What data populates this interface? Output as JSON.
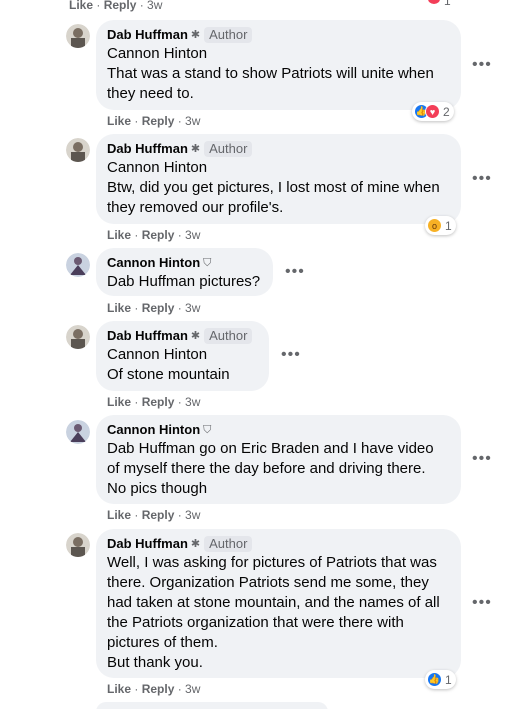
{
  "top": {
    "actions": {
      "like": "Like",
      "sep1": " · ",
      "reply": "Reply",
      "sep2": " · ",
      "time": "3w"
    },
    "reaction_count": "1"
  },
  "comments": [
    {
      "author": "Dab Huffman",
      "badge": "Author",
      "mention": "Cannon Hinton",
      "text": "That was a stand to show Patriots will unite when\nthey need to.",
      "actions": {
        "like": "Like",
        "reply": "Reply",
        "time": "3w"
      },
      "reactions": [
        "like-icon",
        "love-icon"
      ],
      "reaction_count": "2"
    },
    {
      "author": "Dab Huffman",
      "badge": "Author",
      "mention": "Cannon Hinton",
      "text": "Btw, did you get pictures, I lost most of mine when\nthey removed our profile's.",
      "actions": {
        "like": "Like",
        "reply": "Reply",
        "time": "3w"
      },
      "reactions": [
        "wow-icon"
      ],
      "reaction_count": "1"
    },
    {
      "author": "Cannon Hinton",
      "mention": "Dab Huffman",
      "text": " pictures?",
      "actions": {
        "like": "Like",
        "reply": "Reply",
        "time": "3w"
      }
    },
    {
      "author": "Dab Huffman",
      "badge": "Author",
      "mention": "Cannon Hinton",
      "text": "Of stone mountain",
      "actions": {
        "like": "Like",
        "reply": "Reply",
        "time": "3w"
      }
    },
    {
      "author": "Cannon Hinton",
      "mention": "Dab Huffman",
      "text": " go on Eric Braden and I have video\nof myself there the day before and driving there.\nNo pics though",
      "actions": {
        "like": "Like",
        "reply": "Reply",
        "time": "3w"
      }
    },
    {
      "author": "Dab Huffman",
      "badge": "Author",
      "text": "Well, I was asking for pictures of Patriots that was\nthere. Organization Patriots send me some, they\nhad taken at stone mountain, and the names of all\nthe Patriots organization that were there with\npictures of them.\nBut thank you.",
      "actions": {
        "like": "Like",
        "reply": "Reply",
        "time": "3w"
      },
      "reactions": [
        "like-icon"
      ],
      "reaction_count": "1"
    }
  ],
  "colors": {
    "bubble": "#f0f2f5",
    "meta_text": "#65676b",
    "like_blue": "#1877f2",
    "love_red": "#f33e58",
    "wow_yellow": "#f7b125"
  }
}
